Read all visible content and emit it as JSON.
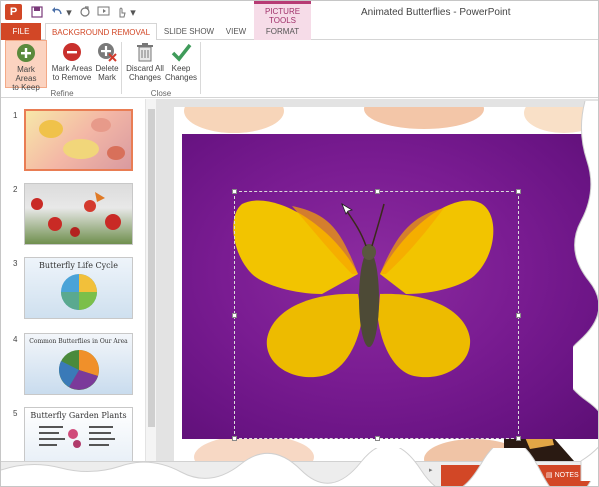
{
  "window": {
    "title": "Animated Butterflies - PowerPoint",
    "contextual_group": "PICTURE TOOLS"
  },
  "tabs": {
    "file": "FILE",
    "background_removal": "BACKGROUND REMOVAL",
    "slide_show": "SLIDE SHOW",
    "view": "VIEW",
    "format": "FORMAT"
  },
  "ribbon": {
    "mark_keep": [
      "Mark Areas",
      "to Keep"
    ],
    "mark_remove": [
      "Mark Areas",
      "to Remove"
    ],
    "delete_mark": [
      "Delete",
      "Mark"
    ],
    "discard": [
      "Discard All",
      "Changes"
    ],
    "keep_changes": [
      "Keep",
      "Changes"
    ],
    "group_refine": "Refine",
    "group_close": "Close"
  },
  "slides": [
    {
      "num": "1"
    },
    {
      "num": "2"
    },
    {
      "num": "3",
      "title": "Butterfly Life Cycle"
    },
    {
      "num": "4",
      "title": "Common Butterflies in Our Area"
    },
    {
      "num": "5",
      "title": "Butterfly Garden Plants"
    }
  ],
  "statusbar": {
    "notes": "NOTES"
  },
  "colors": {
    "accent": "#d24726",
    "picture_tools": "#b73b74",
    "background_mark": "#7a1c92",
    "butterfly": "#f2c400"
  },
  "icons": {
    "keep": "plus-circle-icon",
    "remove": "minus-circle-icon",
    "delete": "delete-mark-icon",
    "discard": "trash-icon",
    "keep_changes": "checkmark-icon"
  }
}
